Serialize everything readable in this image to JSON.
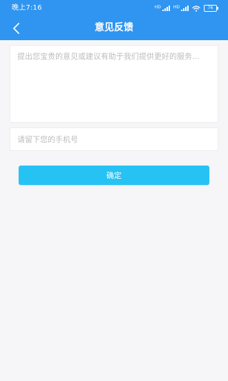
{
  "status_bar": {
    "time": "晚上7:16",
    "signal_label_1": "HD",
    "signal_label_2": "HD",
    "wifi_icon": "wifi-icon",
    "battery_level": "76"
  },
  "nav": {
    "title": "意见反馈",
    "back_icon": "chevron-left-icon"
  },
  "form": {
    "feedback_placeholder": "提出您宝贵的意见或建议有助于我们提供更好的服务...",
    "feedback_value": "",
    "phone_placeholder": "请留下您的手机号",
    "phone_value": "",
    "confirm_label": "确定"
  },
  "colors": {
    "header": "#2f95f1",
    "confirm_button": "#27c2f4",
    "background": "#f6f6f8"
  }
}
